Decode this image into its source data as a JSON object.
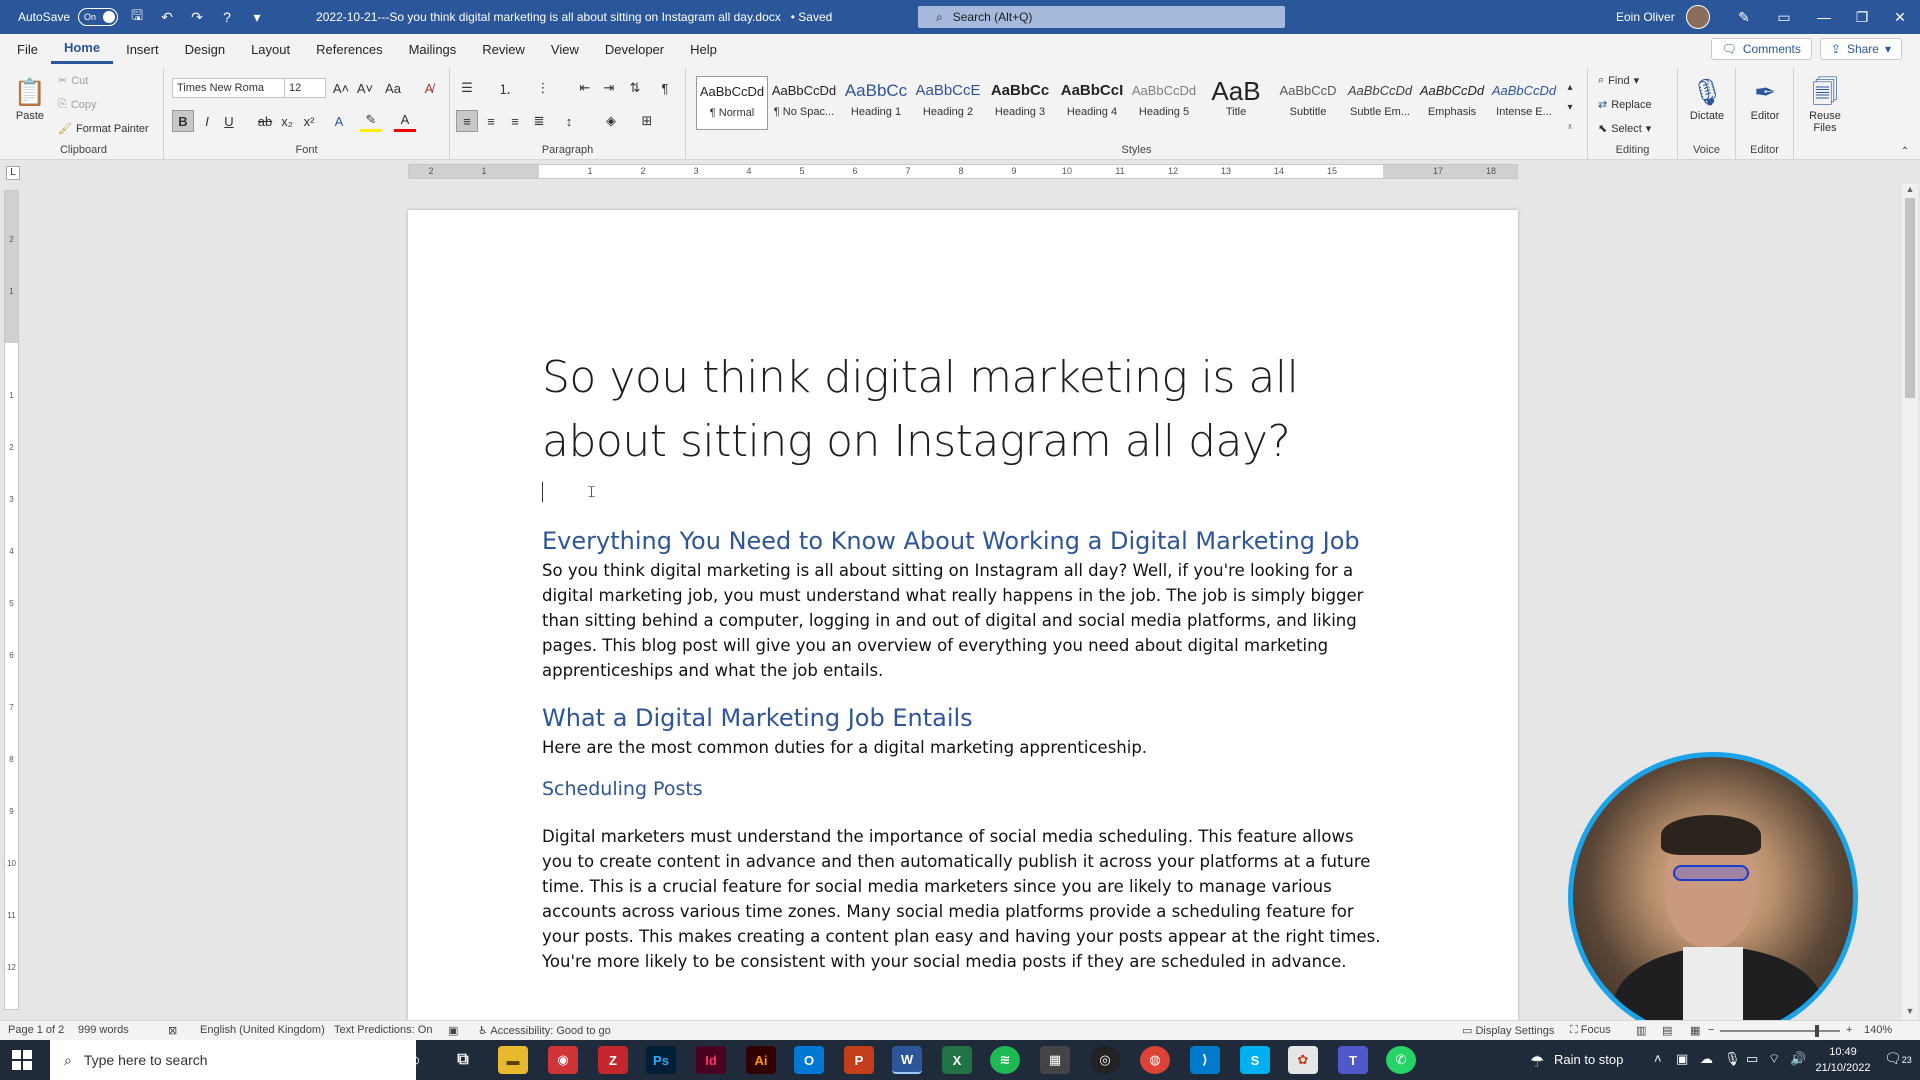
{
  "titlebar": {
    "autosave_label": "AutoSave",
    "autosave_state": "On",
    "doc_title": "2022-10-21---So you think digital marketing is all about sitting on Instagram all day.docx",
    "saved_status": "• Saved",
    "search_placeholder": "Search (Alt+Q)",
    "user_name": "Eoin Oliver"
  },
  "menu": {
    "tabs": [
      "File",
      "Home",
      "Insert",
      "Design",
      "Layout",
      "References",
      "Mailings",
      "Review",
      "View",
      "Developer",
      "Help"
    ],
    "active_tab": "Home",
    "comments_label": "Comments",
    "share_label": "Share"
  },
  "ribbon": {
    "clipboard": {
      "paste": "Paste",
      "cut": "Cut",
      "copy": "Copy",
      "format_painter": "Format Painter",
      "label": "Clipboard"
    },
    "font": {
      "font_name": "Times New Roma",
      "font_size": "12",
      "label": "Font"
    },
    "paragraph": {
      "label": "Paragraph"
    },
    "styles": {
      "label": "Styles",
      "items": [
        {
          "sample": "AaBbCcDd",
          "name": "¶ Normal"
        },
        {
          "sample": "AaBbCcDd",
          "name": "¶ No Spac..."
        },
        {
          "sample": "AaBbCc",
          "name": "Heading 1"
        },
        {
          "sample": "AaBbCcE",
          "name": "Heading 2"
        },
        {
          "sample": "AaBbCc",
          "name": "Heading 3"
        },
        {
          "sample": "AaBbCcI",
          "name": "Heading 4"
        },
        {
          "sample": "AaBbCcDd",
          "name": "Heading 5"
        },
        {
          "sample": "AaB",
          "name": "Title"
        },
        {
          "sample": "AaBbCcD",
          "name": "Subtitle"
        },
        {
          "sample": "AaBbCcDd",
          "name": "Subtle Em..."
        },
        {
          "sample": "AaBbCcDd",
          "name": "Emphasis"
        },
        {
          "sample": "AaBbCcDd",
          "name": "Intense E..."
        }
      ]
    },
    "editing": {
      "find": "Find",
      "replace": "Replace",
      "select": "Select",
      "label": "Editing"
    },
    "voice": {
      "dictate": "Dictate",
      "label": "Voice"
    },
    "editor": {
      "editor": "Editor",
      "label": "Editor"
    },
    "reuse": {
      "reuse_files": "Reuse Files",
      "label": "Reuse Files"
    }
  },
  "ruler": {
    "h_numbers": [
      "2",
      "1",
      "",
      "1",
      "2",
      "3",
      "4",
      "5",
      "6",
      "7",
      "8",
      "9",
      "10",
      "11",
      "12",
      "13",
      "14",
      "15",
      "",
      "17",
      "18"
    ],
    "v_numbers": [
      "2",
      "1",
      "",
      "1",
      "2",
      "3",
      "4",
      "5",
      "6",
      "7",
      "8",
      "9",
      "10",
      "11",
      "12"
    ]
  },
  "document": {
    "title": "So you think digital marketing is all about sitting on Instagram all day?",
    "h1": "Everything You Need to Know About Working a Digital Marketing Job",
    "p1": "So you think digital marketing is all about sitting on Instagram all day? Well, if you're looking for a digital marketing job, you must understand what really happens in the job. The job is simply bigger than sitting behind a computer, logging in and out of digital and social media platforms, and liking pages. This blog post will give you an overview of everything you need about digital marketing apprenticeships and what the job entails.",
    "h2": "What a Digital Marketing Job Entails",
    "p2": "Here are the most common duties for a digital marketing apprenticeship.",
    "h3": "Scheduling Posts",
    "p3": "Digital marketers must understand the importance of social media scheduling. This feature allows you to create content in advance and then automatically publish it across your platforms at a future time. This is a crucial feature for social media marketers since you are likely to manage various accounts across various time zones. Many social media platforms provide a scheduling feature for your posts. This makes creating a content plan easy and having your posts appear at the right times. You're more likely to be consistent with your social media posts if they are scheduled in advance."
  },
  "statusbar": {
    "page": "Page 1 of 2",
    "words": "999 words",
    "language": "English (United Kingdom)",
    "predictions": "Text Predictions: On",
    "accessibility": "Accessibility: Good to go",
    "display_settings": "Display Settings",
    "focus": "Focus",
    "zoom": "140%"
  },
  "taskbar": {
    "search_placeholder": "Type here to search",
    "weather": "Rain to stop",
    "time": "10:49",
    "date": "21/10/2022",
    "notification_count": "23"
  },
  "colors": {
    "word_blue": "#2b579a",
    "heading_blue": "#2f5597",
    "webcam_ring": "#1aa3e8"
  }
}
